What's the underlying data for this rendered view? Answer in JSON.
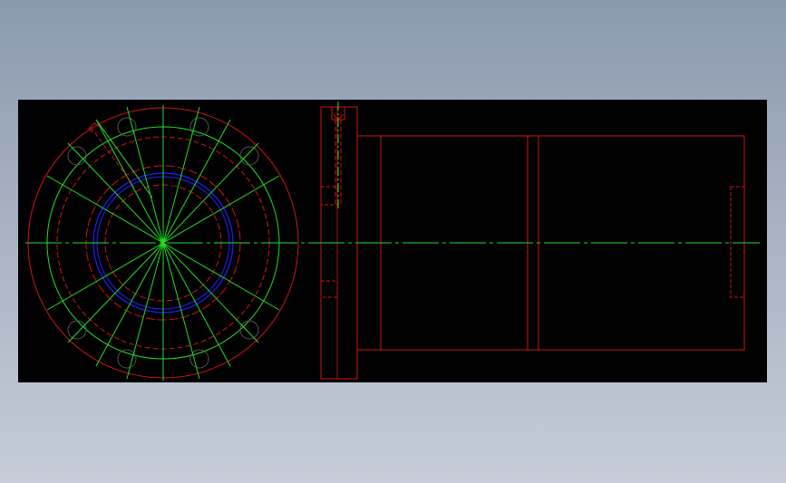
{
  "drawing": {
    "colors": {
      "background": "#000000",
      "outline": "#d01515",
      "centerline": "#22e022",
      "bore": "#2020ff",
      "page_top": "#8b9ab0",
      "page_bottom": "#c6ccd8"
    },
    "views": [
      "front-view",
      "side-view"
    ]
  }
}
